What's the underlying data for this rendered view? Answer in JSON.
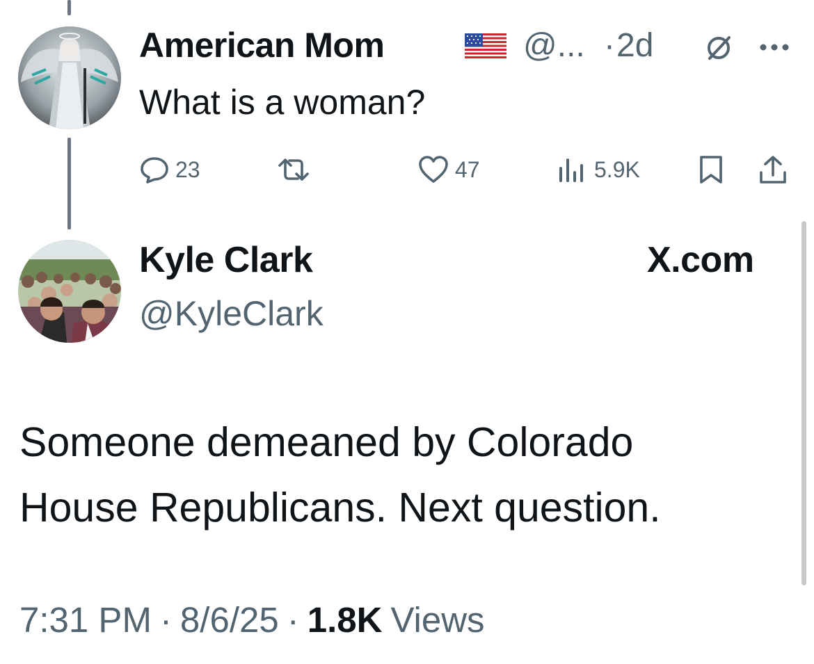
{
  "parent_tweet": {
    "author_name": "American Mom",
    "flag_icon": "us-flag-icon",
    "handle": "@...",
    "separator": "·",
    "time_ago": "2d",
    "text": "What is a woman?",
    "actions": {
      "replies": "23",
      "reposts": "",
      "likes": "47",
      "views": "5.9K"
    }
  },
  "main_tweet": {
    "author_name": "Kyle Clark",
    "handle": "@KyleClark",
    "brand": "X.com",
    "text_line1": "Someone demeaned by Colorado",
    "text_line2": "House Republicans. Next question.",
    "time": "7:31 PM",
    "sep1": "·",
    "date": "8/6/25",
    "sep2": "·",
    "views_count": "1.8K",
    "views_label": "Views"
  },
  "colors": {
    "text": "#0f1419",
    "muted": "#536471",
    "thread_line": "#6b7280"
  }
}
